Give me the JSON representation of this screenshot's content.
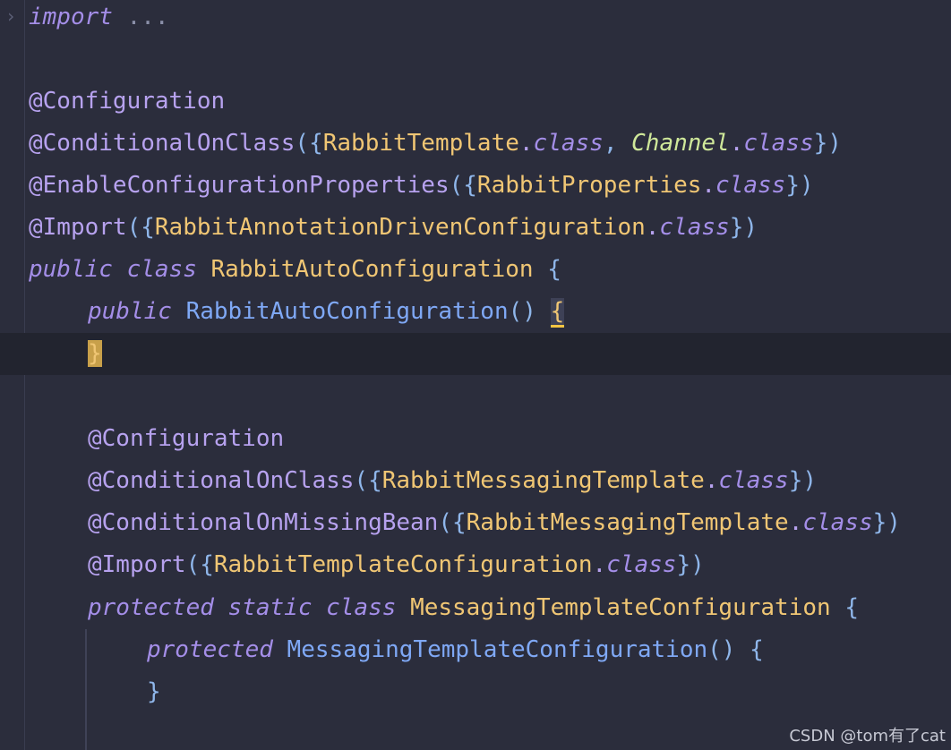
{
  "editor": {
    "fold_toggle": "›",
    "lines": {
      "l1": {
        "kw": "import",
        "rest": " ..."
      },
      "l3": {
        "ann": "@Configuration"
      },
      "l4": {
        "ann": "@ConditionalOnClass",
        "open": "({",
        "t1": "RabbitTemplate",
        "dot1": ".",
        "k1": "class",
        "comma": ", ",
        "t2": "Channel",
        "dot2": ".",
        "k2": "class",
        "close": "})"
      },
      "l5": {
        "ann": "@EnableConfigurationProperties",
        "open": "({",
        "t1": "RabbitProperties",
        "dot1": ".",
        "k1": "class",
        "close": "})"
      },
      "l6": {
        "ann": "@Import",
        "open": "({",
        "t1": "RabbitAnnotationDrivenConfiguration",
        "dot1": ".",
        "k1": "class",
        "close": "})"
      },
      "l7": {
        "kw1": "public",
        "kw2": "class",
        "name": "RabbitAutoConfiguration",
        "brace": "{"
      },
      "l8": {
        "kw1": "public",
        "name": "RabbitAutoConfiguration",
        "parens": "()",
        "brace": "{"
      },
      "l9": {
        "brace": "}"
      },
      "l11": {
        "ann": "@Configuration"
      },
      "l12": {
        "ann": "@ConditionalOnClass",
        "open": "({",
        "t1": "RabbitMessagingTemplate",
        "dot1": ".",
        "k1": "class",
        "close": "})"
      },
      "l13": {
        "ann": "@ConditionalOnMissingBean",
        "open": "({",
        "t1": "RabbitMessagingTemplate",
        "dot1": ".",
        "k1": "class",
        "close": "})"
      },
      "l14": {
        "ann": "@Import",
        "open": "({",
        "t1": "RabbitTemplateConfiguration",
        "dot1": ".",
        "k1": "class",
        "close": "})"
      },
      "l15": {
        "kw1": "protected",
        "kw2": "static",
        "kw3": "class",
        "name": "MessagingTemplateConfiguration",
        "brace": "{"
      },
      "l16": {
        "kw1": "protected",
        "name": "MessagingTemplateConfiguration",
        "parens": "()",
        "brace": "{"
      },
      "l17": {
        "brace": "}"
      }
    }
  },
  "watermark": "CSDN @tom有了cat",
  "colors": {
    "background": "#2b2d3c",
    "annotation": "#b7a2ef",
    "keyword": "#a48ee8",
    "type": "#f0c674",
    "function": "#7fa8f5",
    "highlight": "#f5c542"
  }
}
